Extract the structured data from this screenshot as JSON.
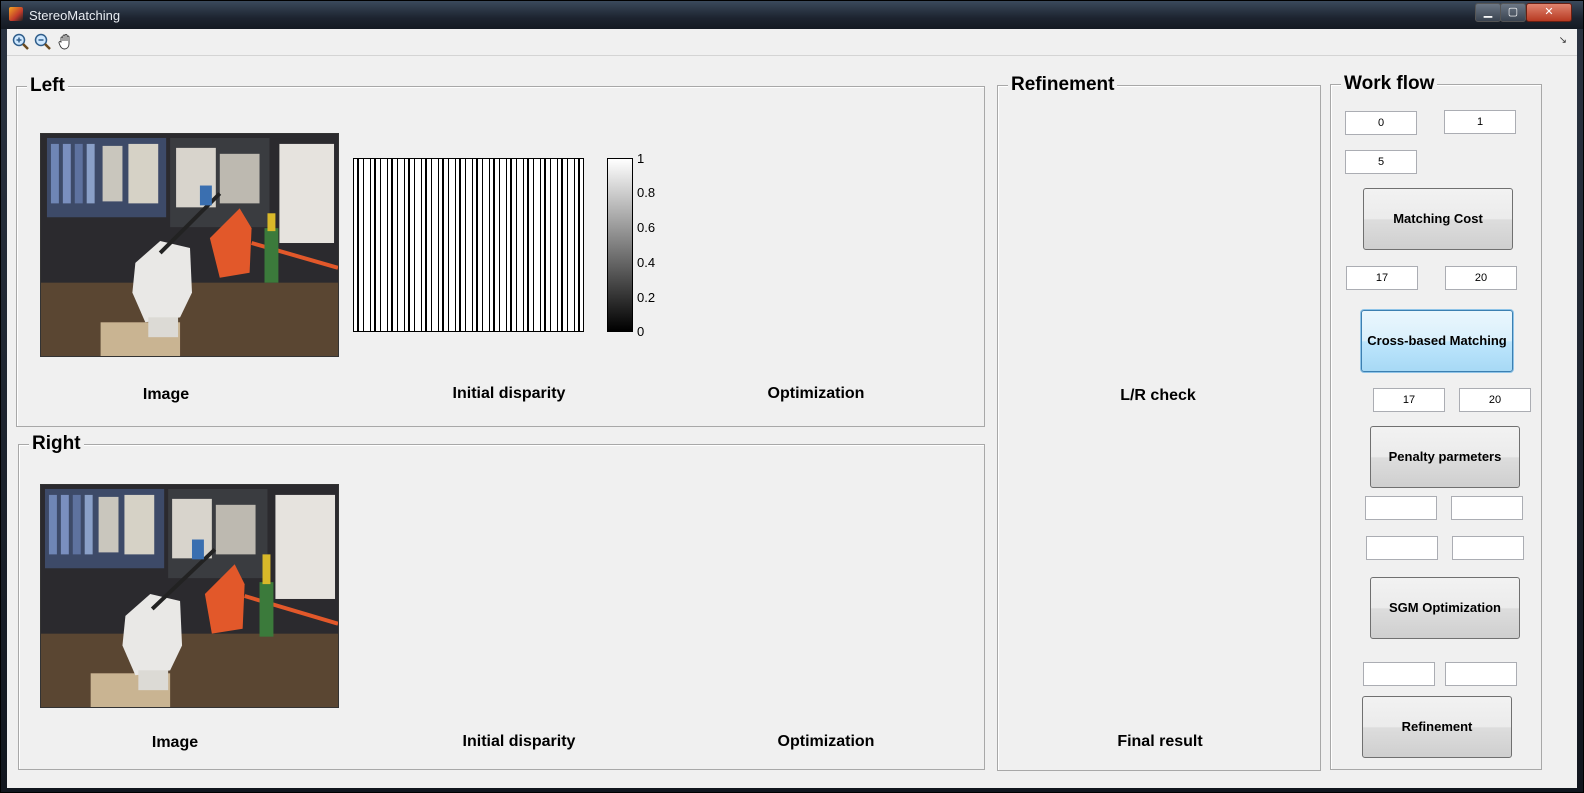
{
  "window": {
    "title": "StereoMatching",
    "controls": {
      "minimize": "▁",
      "maximize": "▢",
      "close": "✕"
    }
  },
  "toolbar": {
    "tools": [
      {
        "name": "zoom-in",
        "icon": "zoom-in-icon"
      },
      {
        "name": "zoom-out",
        "icon": "zoom-out-icon"
      },
      {
        "name": "pan",
        "icon": "pan-hand-icon"
      }
    ],
    "dock": "↘"
  },
  "left_panel": {
    "title": "Left",
    "captions": {
      "image": "Image",
      "initial": "Initial disparity",
      "optimization": "Optimization"
    },
    "colorbar_ticks": [
      "1",
      "0.8",
      "0.6",
      "0.4",
      "0.2",
      "0"
    ]
  },
  "right_panel": {
    "title": "Right",
    "captions": {
      "image": "Image",
      "initial": "Initial disparity",
      "optimization": "Optimization"
    }
  },
  "refinement_panel": {
    "title": "Refinement",
    "captions": {
      "lr_check": "L/R check",
      "final": "Final result"
    }
  },
  "workflow": {
    "title": "Work flow",
    "fields": {
      "f1": "0",
      "f2": "1",
      "f3": "5",
      "f4": "17",
      "f5": "20",
      "f6": "17",
      "f7": "20",
      "f8": "",
      "f9": "",
      "f10": "",
      "f11": "",
      "f12": "",
      "f13": ""
    },
    "buttons": {
      "matching_cost": "Matching Cost",
      "cross_based": "Cross-based Matching",
      "penalty": "Penalty parmeters",
      "sgm": "SGM Optimization",
      "refinement": "Refinement"
    }
  },
  "colors": {
    "accent_active": "#bee6fd",
    "panel_bg": "#f0f0f0"
  }
}
